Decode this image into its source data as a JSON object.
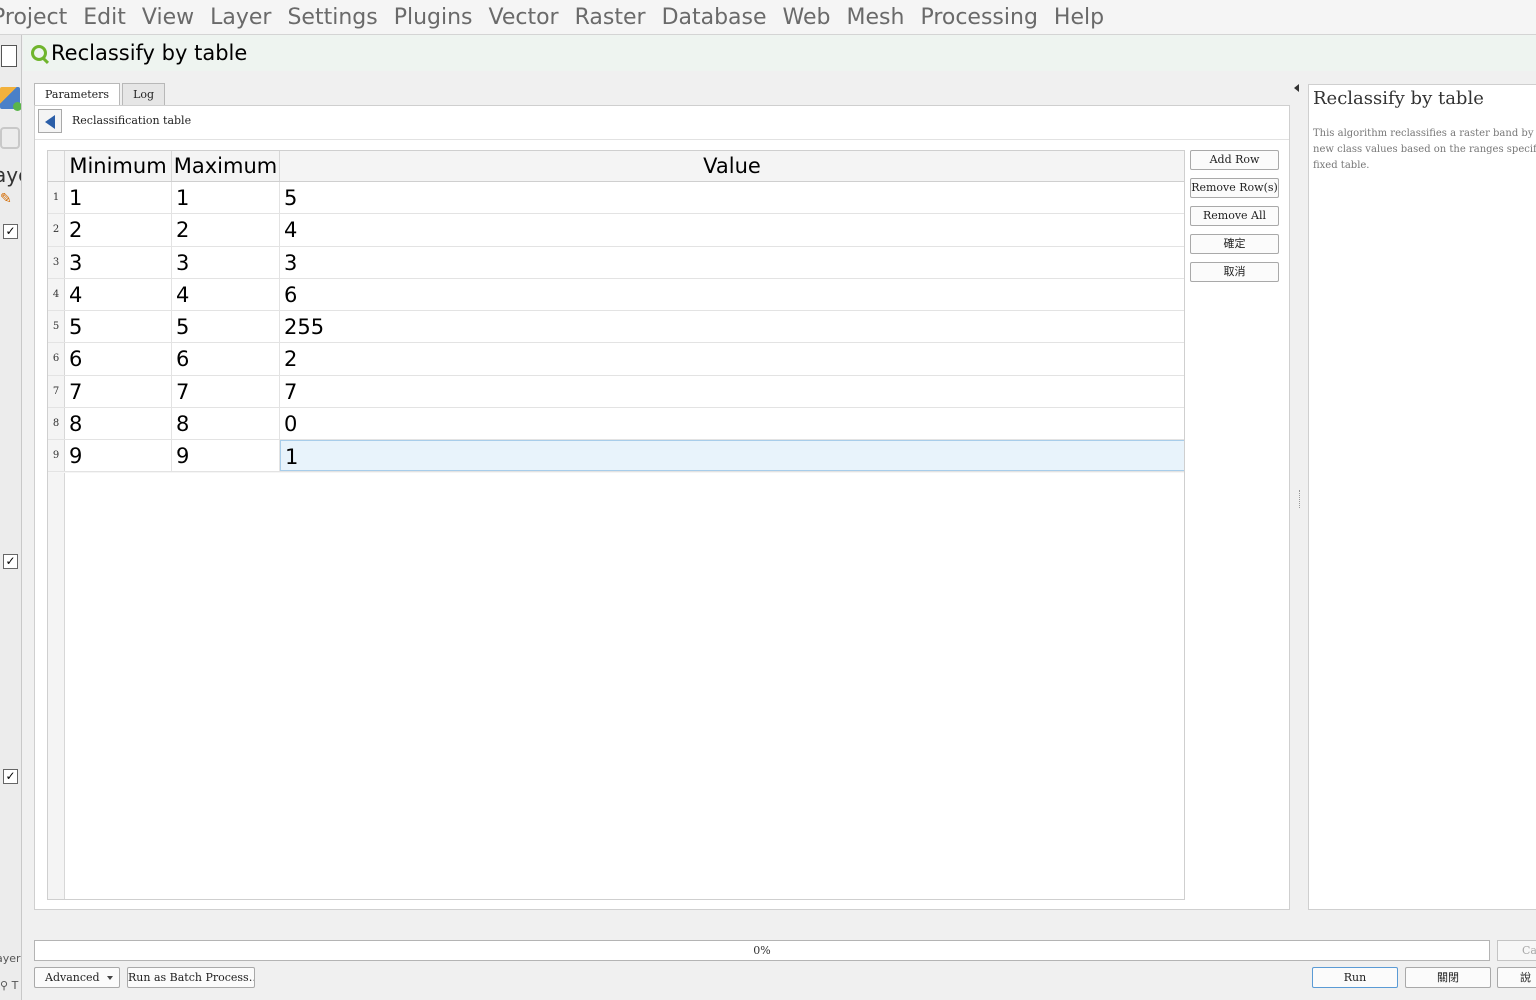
{
  "menubar": {
    "items": [
      "Project",
      "Edit",
      "View",
      "Layer",
      "Settings",
      "Plugins",
      "Vector",
      "Raster",
      "Database",
      "Web",
      "Mesh",
      "Processing",
      "Help"
    ]
  },
  "left_panel": {
    "partial_label": "aye",
    "bottom_label_1": "ayers",
    "bottom_label_2": "T"
  },
  "dialog": {
    "title": "Reclassify by table",
    "tabs": [
      "Parameters",
      "Log"
    ],
    "section_label": "Reclassification table",
    "table": {
      "headers": [
        "Minimum",
        "Maximum",
        "Value"
      ],
      "rows": [
        {
          "num": "1",
          "min": "1",
          "max": "1",
          "value": "5"
        },
        {
          "num": "2",
          "min": "2",
          "max": "2",
          "value": "4"
        },
        {
          "num": "3",
          "min": "3",
          "max": "3",
          "value": "3"
        },
        {
          "num": "4",
          "min": "4",
          "max": "4",
          "value": "6"
        },
        {
          "num": "5",
          "min": "5",
          "max": "5",
          "value": "255"
        },
        {
          "num": "6",
          "min": "6",
          "max": "6",
          "value": "2"
        },
        {
          "num": "7",
          "min": "7",
          "max": "7",
          "value": "7"
        },
        {
          "num": "8",
          "min": "8",
          "max": "8",
          "value": "0"
        },
        {
          "num": "9",
          "min": "9",
          "max": "9",
          "value": "1"
        }
      ]
    },
    "side_buttons": {
      "add_row": "Add Row",
      "remove_rows": "Remove Row(s)",
      "remove_all": "Remove All",
      "ok": "確定",
      "cancel": "取消"
    },
    "help": {
      "title": "Reclassify by table",
      "line1": "This algorithm reclassifies a raster band by as",
      "line2": "new class values based on the ranges specifie",
      "line3": "fixed table."
    },
    "progress": {
      "text": "0%",
      "fraction": 0
    },
    "bottom": {
      "cancel_partial": "Ca",
      "advanced": "Advanced",
      "batch": "Run as Batch Process…",
      "run": "Run",
      "close": "關閉",
      "help_partial": "說"
    }
  }
}
